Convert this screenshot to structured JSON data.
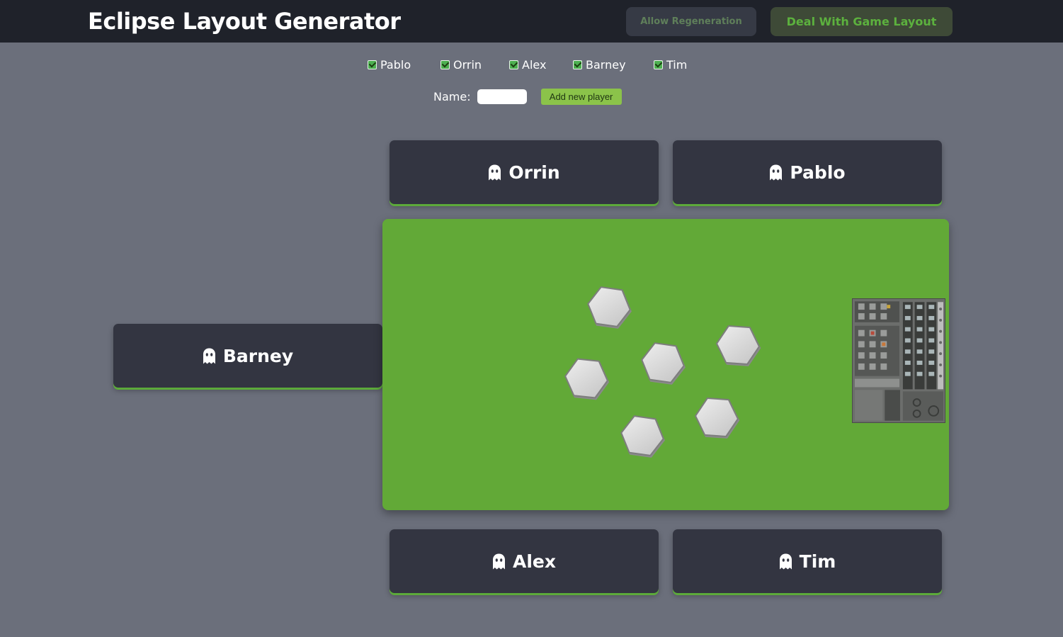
{
  "header": {
    "title": "Eclipse Layout Generator",
    "regen_label": "Allow Regeneration",
    "deal_label": "Deal With Game Layout"
  },
  "player_selector": {
    "players": [
      {
        "name": "Pablo",
        "checked": true
      },
      {
        "name": "Orrin",
        "checked": true
      },
      {
        "name": "Alex",
        "checked": true
      },
      {
        "name": "Barney",
        "checked": true
      },
      {
        "name": "Tim",
        "checked": true
      }
    ],
    "name_label": "Name:",
    "name_value": "",
    "add_label": "Add new player"
  },
  "seats": {
    "top_left": "Orrin",
    "top_right": "Pablo",
    "left": "Barney",
    "bottom_left": "Alex",
    "bottom_right": "Tim"
  },
  "board": {
    "hex_tile_count": 6,
    "has_player_board": true
  },
  "colors": {
    "accent_green": "#5cb13e",
    "board_green": "#62a937",
    "card_bg": "#333541",
    "page_bg": "#6b6f7b",
    "topbar_bg": "#1f222a"
  }
}
